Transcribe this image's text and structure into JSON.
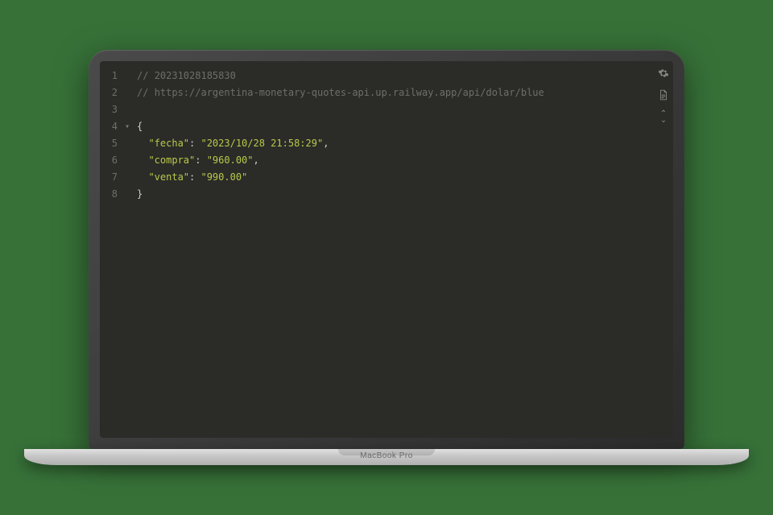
{
  "device_brand": "MacBook Pro",
  "editor": {
    "line_numbers": [
      "1",
      "2",
      "3",
      "4",
      "5",
      "6",
      "7",
      "8"
    ],
    "fold_marker_line": 4,
    "fold_marker_glyph": "▾"
  },
  "code": {
    "comment1_prefix": "// ",
    "comment1_text": "20231028185830",
    "comment2_prefix": "// ",
    "comment2_text": "https://argentina-monetary-quotes-api.up.railway.app/api/dolar/blue",
    "open_brace": "{",
    "close_brace": "}",
    "entries": [
      {
        "key": "\"fecha\"",
        "colon": ": ",
        "value": "\"2023/10/28 21:58:29\"",
        "comma": ","
      },
      {
        "key": "\"compra\"",
        "colon": ": ",
        "value": "\"960.00\"",
        "comma": ","
      },
      {
        "key": "\"venta\"",
        "colon": ": ",
        "value": "\"990.00\"",
        "comma": ""
      }
    ],
    "indent": "  "
  },
  "icons": {
    "gear": "gear-icon",
    "file": "file-icon",
    "chevrons": "chevron-updown-icon"
  }
}
